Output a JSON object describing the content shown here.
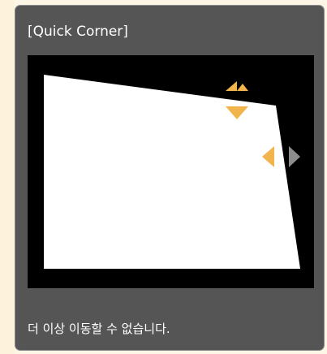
{
  "dialog": {
    "title": "[Quick Corner]",
    "message": "더 이상 이동할 수 없습니다."
  },
  "controls": {
    "vertical_arrows": {
      "icon": "up-down-arrow-icon",
      "color": "#f2b44c"
    },
    "horizontal_arrows": {
      "left_icon": "left-arrow-icon",
      "right_icon": "right-arrow-icon",
      "active_color": "#f2b44c",
      "disabled_color": "#8d8d8d"
    }
  },
  "colors": {
    "panel_background": "#555555",
    "screen_background": "#000000",
    "image_fill": "#ffffff",
    "page_background": "#fdf6e6"
  }
}
